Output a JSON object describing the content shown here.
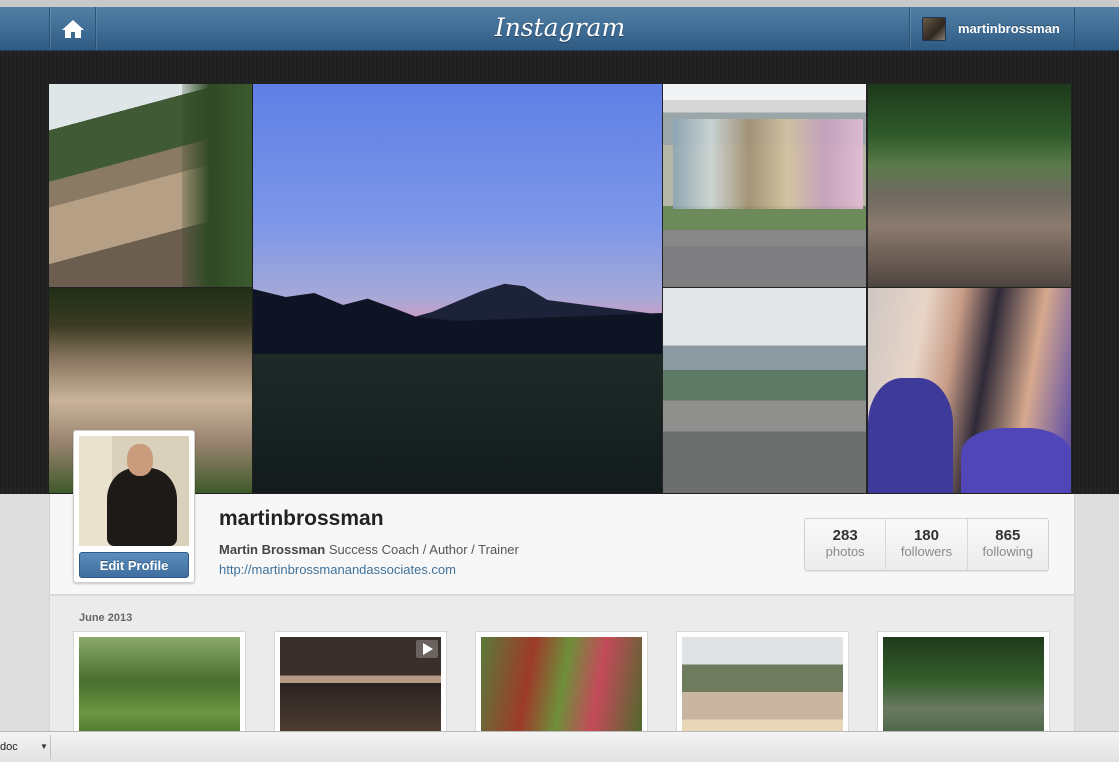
{
  "nav": {
    "brand": "Instagram",
    "username": "martinbrossman"
  },
  "profile": {
    "username": "martinbrossman",
    "full_name": "Martin Brossman",
    "bio": "Success Coach / Author / Trainer",
    "url": "http://martinbrossmanandassociates.com",
    "edit_label": "Edit Profile",
    "stats": [
      {
        "value": "283",
        "label": "photos"
      },
      {
        "value": "180",
        "label": "followers"
      },
      {
        "value": "865",
        "label": "following"
      }
    ]
  },
  "feed": {
    "month": "June 2013"
  },
  "download_bar": {
    "item_label": "doc"
  },
  "colors": {
    "navbar": "#3f6c94",
    "link": "#3f729b",
    "button": "#4a7aab"
  }
}
